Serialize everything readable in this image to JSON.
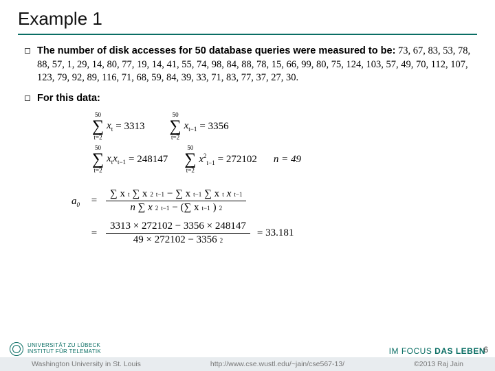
{
  "title": "Example 1",
  "bullets": {
    "b1_lead": "The number of disk accesses for 50 database queries were measured to be:",
    "b1_data": " 73,  67, 83, 53, 78, 88, 57, 1, 29, 14, 80, 77, 19, 14, 41, 55, 74, 98, 84, 88, 78,  15, 66, 99, 80, 75, 124, 103, 57, 49, 70, 112, 107, 123, 79, 92, 89, 116, 71,  68, 59, 84, 39, 33, 71, 83, 77, 37, 27, 30.",
    "b2": "For this data:"
  },
  "math": {
    "sum_top": "50",
    "sum_bot": "t=2",
    "sigma": "∑",
    "xt": "x",
    "r1_a_rhs": " = 3313",
    "r1_b_rhs": " = 3356",
    "r2_a_rhs": " = 248147",
    "r2_b_rhs": " = 272102",
    "n_lbl": "n = 49",
    "xt_sub_t": "t",
    "xt_sub_tm1": "t−1",
    "xprod_sub": "t",
    "xprod_sub2": "t−1",
    "sq": "2"
  },
  "a0": {
    "lhs": "a",
    "lhs_sub": "0",
    "eq": "=",
    "num1_a": "∑ x",
    "num1_b": "∑ x",
    "num1_c": " − ∑ x",
    "num1_d": "∑ x",
    "den1_a": "n ∑ x",
    "den1_b": " − (∑ x",
    "den1_c": ")",
    "num2": "3313 × 272102 − 3356 × 248147",
    "den2": "49 × 272102 − 3356",
    "rhs2": " = 33.181"
  },
  "footer": {
    "uni1": "UNIVERSITÄT ZU LÜBECK",
    "uni2": "INSTITUT FÜR TELEMATIK",
    "slogan_a": "IM FOCUS ",
    "slogan_b": "DAS LEBEN",
    "page": "6",
    "attr_left": "Washington University in St. Louis",
    "attr_mid": "http://www.cse.wustl.edu/~jain/cse567-13/",
    "attr_right": "©2013 Raj Jain"
  }
}
